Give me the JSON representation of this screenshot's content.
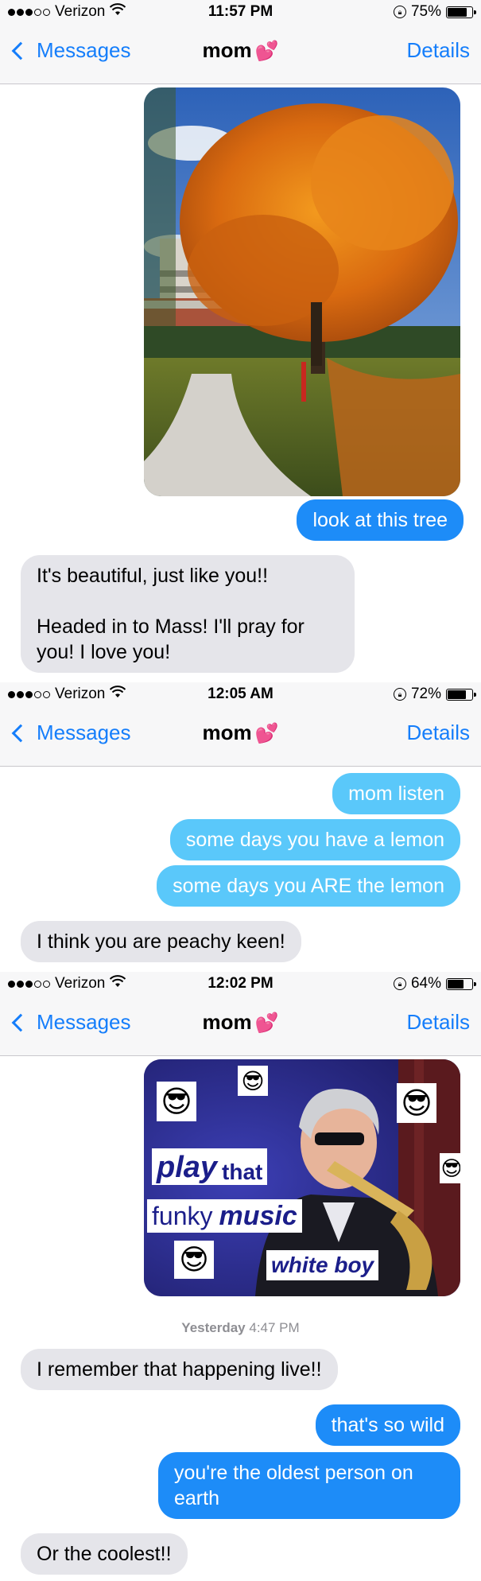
{
  "screens": [
    {
      "status": {
        "carrier": "Verizon",
        "time": "11:57 PM",
        "battery": "75%",
        "battery_level": 0.75
      },
      "nav": {
        "back": "Messages",
        "title": "mom",
        "details": "Details"
      },
      "messages": [
        {
          "type": "image",
          "direction": "outgoing",
          "image": "autumn-tree-photo"
        },
        {
          "type": "text",
          "direction": "outgoing",
          "text": "look at this tree"
        },
        {
          "type": "text",
          "direction": "incoming",
          "text": "It's beautiful, just like you!!\n\nHeaded in to Mass! I'll pray for you! I love you!"
        }
      ]
    },
    {
      "status": {
        "carrier": "Verizon",
        "time": "12:05 AM",
        "battery": "72%",
        "battery_level": 0.72
      },
      "nav": {
        "back": "Messages",
        "title": "mom",
        "details": "Details"
      },
      "messages": [
        {
          "type": "text",
          "direction": "outgoing",
          "text": "mom listen"
        },
        {
          "type": "text",
          "direction": "outgoing",
          "text": "some days you have a lemon"
        },
        {
          "type": "text",
          "direction": "outgoing",
          "text": "some days you ARE the lemon"
        },
        {
          "type": "text",
          "direction": "incoming",
          "text": "I think you are peachy keen!"
        }
      ]
    },
    {
      "status": {
        "carrier": "Verizon",
        "time": "12:02 PM",
        "battery": "64%",
        "battery_level": 0.64
      },
      "nav": {
        "back": "Messages",
        "title": "mom",
        "details": "Details"
      },
      "meme": {
        "line1a": "play",
        "line1b": "that",
        "line2a": "funky",
        "line2b": "music",
        "line3": "white boy"
      },
      "timestamp": {
        "day": "Yesterday",
        "time": "4:47 PM"
      },
      "messages": [
        {
          "type": "text",
          "direction": "incoming",
          "text": "I remember that happening live!!"
        },
        {
          "type": "text",
          "direction": "outgoing",
          "text": "that's so wild"
        },
        {
          "type": "text",
          "direction": "outgoing",
          "text": "you're the oldest person on earth"
        },
        {
          "type": "text",
          "direction": "incoming",
          "text": "Or the coolest!!"
        }
      ]
    }
  ],
  "colors": {
    "ios_blue": "#157efb",
    "imessage_blue": "#1d8cf8",
    "bubble_gray": "#e5e5ea",
    "heart_pink": "#f25ab7"
  }
}
